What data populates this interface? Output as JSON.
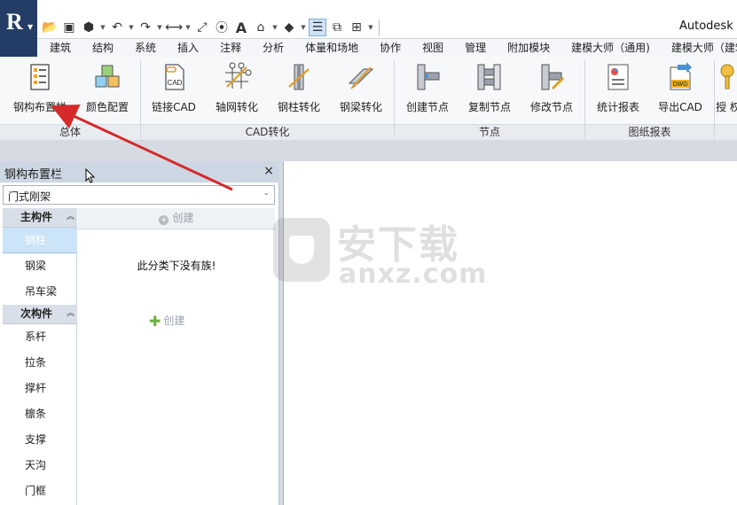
{
  "titlebar": {
    "window_title": "Autodesk R",
    "qat_icons": [
      "open-icon",
      "save-icon",
      "cube-icon",
      "undo-icon",
      "redo-icon",
      "measure-icon",
      "dimension-icon",
      "tag-icon",
      "text-icon",
      "3d-view-icon",
      "section-icon",
      "thin-lines-icon",
      "close-hidden-icon",
      "switch-windows-icon"
    ]
  },
  "menu": {
    "tabs": [
      "建筑",
      "结构",
      "系统",
      "插入",
      "注释",
      "分析",
      "体量和场地",
      "协作",
      "视图",
      "管理",
      "附加模块",
      "建模大师（通用)",
      "建模大师（建筑)"
    ]
  },
  "ribbon": {
    "buttons": [
      {
        "id": "steel-layout",
        "label": "钢构布置栏"
      },
      {
        "id": "color-config",
        "label": "颜色配置"
      },
      {
        "id": "link-cad",
        "label": "链接CAD",
        "icon_text": "CAD"
      },
      {
        "id": "grid-convert",
        "label": "轴网转化"
      },
      {
        "id": "column-convert",
        "label": "钢柱转化"
      },
      {
        "id": "beam-convert",
        "label": "钢梁转化"
      },
      {
        "id": "create-node",
        "label": "创建节点"
      },
      {
        "id": "copy-node",
        "label": "复制节点"
      },
      {
        "id": "edit-node",
        "label": "修改节点"
      },
      {
        "id": "stat-report",
        "label": "统计报表"
      },
      {
        "id": "export-cad",
        "label": "导出CAD",
        "icon_text": "DWG"
      },
      {
        "id": "authorize",
        "label": "授 权"
      }
    ],
    "panels": [
      "总体",
      "CAD转化",
      "节点",
      "图纸报表"
    ]
  },
  "palette": {
    "title": "钢构布置栏",
    "close": "×",
    "select_value": "门式刚架",
    "primary_header": "主构件",
    "primary_items": [
      "钢柱",
      "钢梁",
      "吊车梁"
    ],
    "secondary_header": "次构件",
    "secondary_items": [
      "系杆",
      "拉条",
      "撑杆",
      "檩条",
      "支撑",
      "天沟",
      "门框"
    ],
    "create_top": "创建",
    "empty_message": "此分类下没有族!",
    "create_mid": "创建"
  },
  "watermark": {
    "text": "安下载",
    "sub": "anxz.com"
  },
  "colors": {
    "app_button": "#243d66",
    "selected_item": "#cce4f7",
    "arrow": "#d42a2a",
    "create_plus": "#6db33f"
  }
}
